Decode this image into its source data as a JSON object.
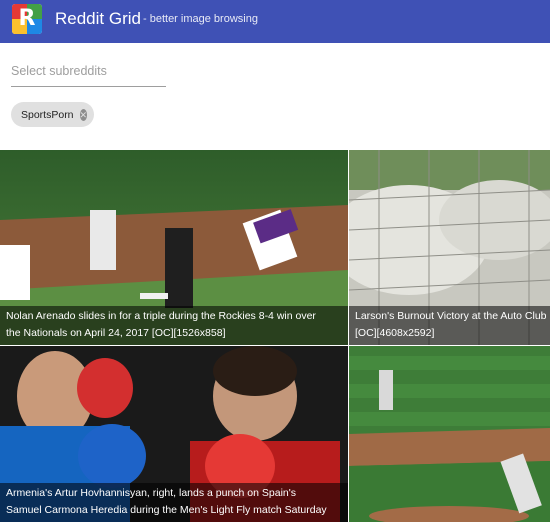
{
  "app": {
    "title": "Reddit Grid",
    "subtitle": "- better image browsing",
    "logo_letter": "R"
  },
  "search": {
    "placeholder": "Select subreddits",
    "value": ""
  },
  "selected_subreddits": [
    {
      "label": "SportsPorn"
    }
  ],
  "posts": [
    {
      "caption_line1": "Nolan Arenado slides in for a triple during the Rockies 8-4 win over",
      "caption_line2": "the Nationals on April 24, 2017 [OC][1526x858]"
    },
    {
      "caption_line1": "Larson's Burnout Victory at the Auto Club",
      "caption_line2": "[OC][4608x2592]"
    },
    {
      "caption_line1": "Armenia's Artur Hovhannisyan, right, lands a punch on Spain's",
      "caption_line2": "Samuel Carmona Heredia during the Men's Light Fly match Saturday"
    },
    {
      "caption_line1": "",
      "caption_line2": ""
    }
  ],
  "colors": {
    "appbar": "#3f51b5",
    "chip": "#e0e0e0"
  }
}
